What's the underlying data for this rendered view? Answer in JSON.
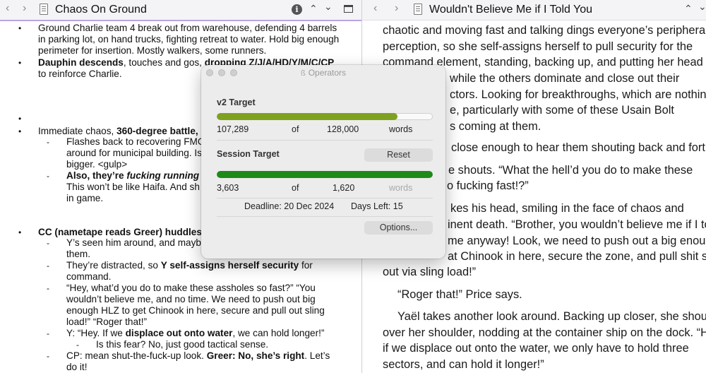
{
  "left_editor": {
    "title": "Chaos On Ground",
    "nav_back": "‹",
    "nav_forward": "›",
    "info_icon": "i",
    "nav_up": "⌃",
    "nav_down": "⌄"
  },
  "right_editor": {
    "title": "Wouldn't Believe Me if I Told You",
    "nav_back": "‹",
    "nav_forward": "›",
    "nav_up": "⌃",
    "nav_down": "⌄"
  },
  "notes": {
    "bullet": "•",
    "dash": "-",
    "l1": "Ground Charlie team 4 break out from warehouse, defending 4 barrels",
    "l2": "in parking lot, on hand trucks, fighting retreat to water. Hold big enough",
    "l3": "perimeter for insertion. Mostly walkers, some runners.",
    "l4a": "Dauphin descends",
    "l4b": ", touches and gos, ",
    "l4c": "dropping",
    "l4d": " ",
    "l4e": "Z/J/A/HD/Y/M/C/CP",
    "l5": "to reinforce Charlie.",
    "l7a": "Immediate chaos, ",
    "l7b": "360-degree battle,",
    "l8": "Flashes back to recovering FMC",
    "l9": "around for municipal building. Is",
    "l10": "bigger. <gulp>",
    "l11a": "Also, they’re ",
    "l11b": "fucking running",
    "l12": "This won’t be like Haifa. And sh",
    "l13": "in game.",
    "l15": "CC (nametape reads Greer) huddles",
    "l16": "Y’s seen him around, and mayb",
    "l17": "them.",
    "l18a": "They’re distracted, so ",
    "l18b": "Y self-assigns herself security",
    "l18c": " for",
    "l19": "command.",
    "l20": "“Hey, what’d you do to make these assholes so fast?” “You",
    "l21": "wouldn’t believe me, and no time. We need to push out big",
    "l22": "enough HLZ to get Chinook in here, secure and pull out sling",
    "l23": "load!” “Roger that!”",
    "l24a": "Y: “Hey. If we ",
    "l24b": "displace out onto water",
    "l24c": ", we can hold longer!”",
    "l25": "Is this fear? No, just good tactical sense.",
    "l26a": "CP: mean shut-the-fuck-up look. ",
    "l26b": "Greer: No, she’s right",
    "l26c": ". Let’s",
    "l27": "do it!"
  },
  "prose": {
    "p1": "chaotic and moving fast and talking dings everyone’s peripheral",
    "p2": "perception, so she self-assigns herself to pull security for the",
    "p3": "command element, standing, backing up, and putting her head on",
    "p4": "while the others dominate and close out their",
    "p5": "ctors. Looking for breakthroughs, which are nothing",
    "p6": "e, particularly with some of these Usain Bolt",
    "p7": "s coming at them.",
    "p8": "close enough to hear them shouting back and forth",
    "p9": "e shouts. “What the hell’d you do to make these",
    "p10": "o fucking fast!?”",
    "p11": "kes his head, smiling in the face of chaos and",
    "p12": "inent death. “Brother, you wouldn’t believe me if I to",
    "p13": "me anyway! Look, we need to push out a big enoug",
    "p14": "at Chinook in here, secure the zone, and pull shit sh",
    "p15": "out via sling load!”",
    "p16": "“Roger that!” Price says.",
    "p17": "Yaël takes another look around. Backing up closer, she shouts",
    "p18": "over her shoulder, nodding at the container ship on the dock. “He",
    "p19": "if we displace out onto the water, we only have to hold three",
    "p20": "sectors, and can hold it longer!”"
  },
  "operators": {
    "title": "Operators",
    "title_glyph": "ß",
    "v2_target": {
      "label": "v2 Target",
      "current": "107,289",
      "of": "of",
      "goal": "128,000",
      "unit": "words",
      "progress_fraction": 0.838,
      "color": "#7ea21f"
    },
    "session_target": {
      "label": "Session Target",
      "reset_label": "Reset",
      "current": "3,603",
      "of": "of",
      "goal": "1,620",
      "unit": "words",
      "progress_fraction": 1.0,
      "color": "#1e8a18"
    },
    "deadline": "Deadline: 20 Dec 2024",
    "days_left": "Days Left: 15",
    "options_label": "Options..."
  }
}
